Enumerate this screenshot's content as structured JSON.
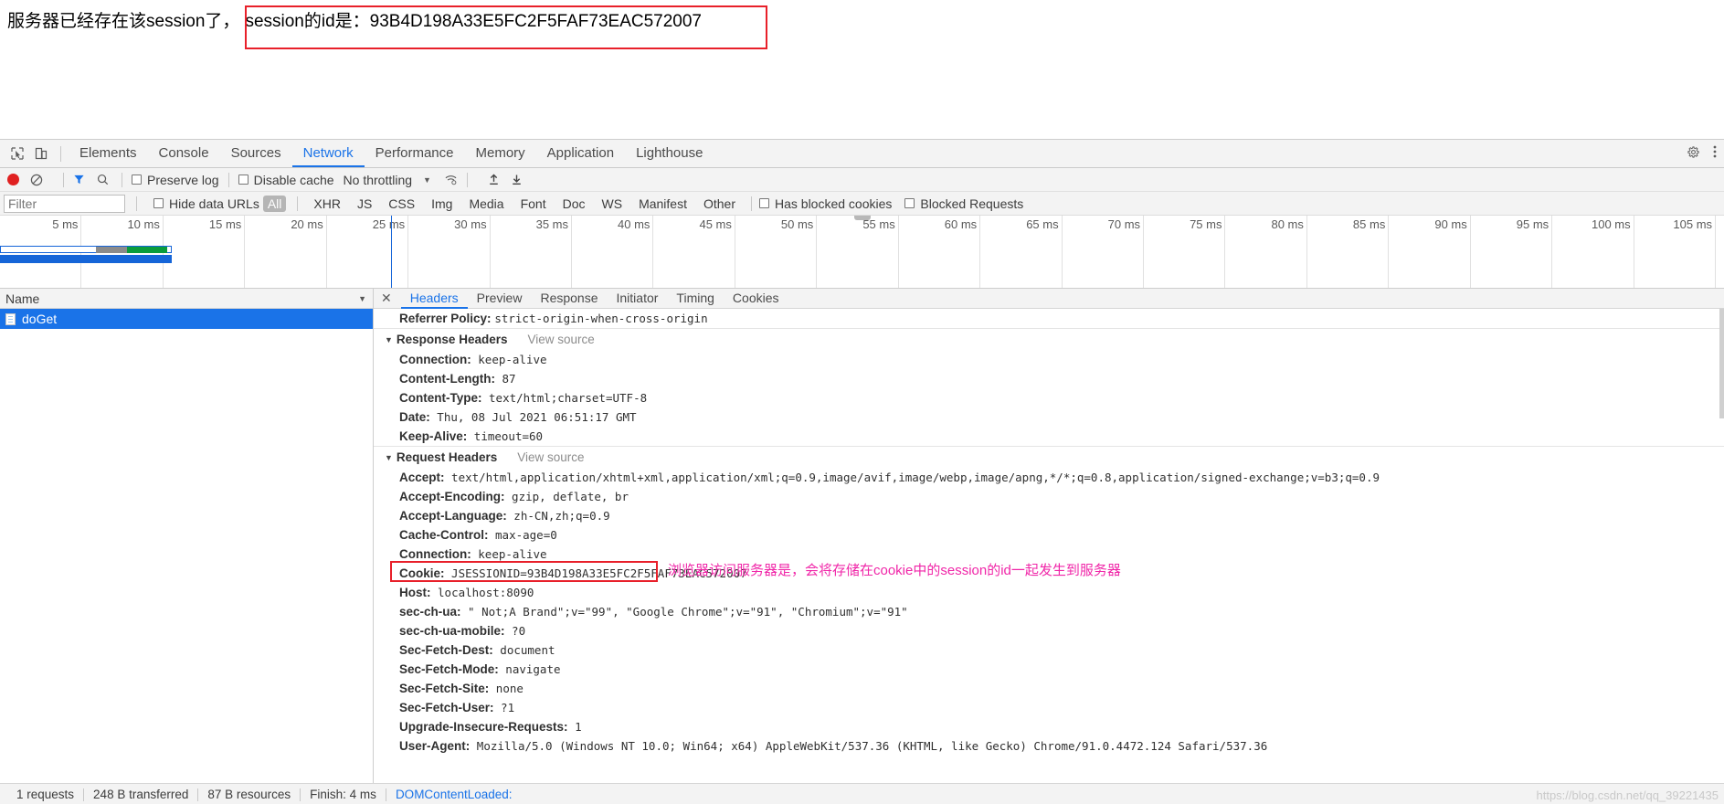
{
  "browser_page": {
    "text_prefix": "服务器已经存在该session了，",
    "highlighted_text": "session的id是：93B4D198A33E5FC2F5FAF73EAC572007",
    "highlight_color": "#e8202a"
  },
  "devtools": {
    "tabs": [
      {
        "label": "Elements",
        "active": false
      },
      {
        "label": "Console",
        "active": false
      },
      {
        "label": "Sources",
        "active": false
      },
      {
        "label": "Network",
        "active": true
      },
      {
        "label": "Performance",
        "active": false
      },
      {
        "label": "Memory",
        "active": false
      },
      {
        "label": "Application",
        "active": false
      },
      {
        "label": "Lighthouse",
        "active": false
      }
    ],
    "toolbar": {
      "record_label": "Record",
      "clear_label": "Clear",
      "filter_toggle_label": "Filter",
      "search_label": "Search",
      "preserve_log": "Preserve log",
      "disable_cache": "Disable cache",
      "throttling": "No throttling",
      "import_label": "Import HAR",
      "export_label": "Export HAR"
    },
    "filterbar": {
      "filter_placeholder": "Filter",
      "hide_data_urls": "Hide data URLs",
      "types": [
        {
          "label": "All",
          "active": true
        },
        {
          "label": "XHR",
          "active": false
        },
        {
          "label": "JS",
          "active": false
        },
        {
          "label": "CSS",
          "active": false
        },
        {
          "label": "Img",
          "active": false
        },
        {
          "label": "Media",
          "active": false
        },
        {
          "label": "Font",
          "active": false
        },
        {
          "label": "Doc",
          "active": false
        },
        {
          "label": "WS",
          "active": false
        },
        {
          "label": "Manifest",
          "active": false
        },
        {
          "label": "Other",
          "active": false
        }
      ],
      "has_blocked_cookies": "Has blocked cookies",
      "blocked_requests": "Blocked Requests"
    },
    "overview": {
      "ticks": [
        "5 ms",
        "10 ms",
        "15 ms",
        "20 ms",
        "25 ms",
        "30 ms",
        "35 ms",
        "40 ms",
        "45 ms",
        "50 ms",
        "55 ms",
        "60 ms",
        "65 ms",
        "70 ms",
        "75 ms",
        "80 ms",
        "85 ms",
        "90 ms",
        "95 ms",
        "100 ms",
        "105 ms"
      ],
      "waterfall_color_wait": "#8b8b8b",
      "waterfall_color_download": "#0b9c3c",
      "event_line_color": "#1565d8"
    },
    "request_list": {
      "column_header": "Name",
      "rows": [
        {
          "name": "doGet",
          "selected": true
        }
      ]
    },
    "detail": {
      "tabs": [
        {
          "label": "Headers",
          "active": true
        },
        {
          "label": "Preview",
          "active": false
        },
        {
          "label": "Response",
          "active": false
        },
        {
          "label": "Initiator",
          "active": false
        },
        {
          "label": "Timing",
          "active": false
        },
        {
          "label": "Cookies",
          "active": false
        }
      ],
      "top_line": {
        "name": "Referrer Policy:",
        "value": "strict-origin-when-cross-origin"
      },
      "response_headers": {
        "title": "Response Headers",
        "view_source": "View source",
        "items": [
          {
            "name": "Connection:",
            "value": "keep-alive"
          },
          {
            "name": "Content-Length:",
            "value": "87"
          },
          {
            "name": "Content-Type:",
            "value": "text/html;charset=UTF-8"
          },
          {
            "name": "Date:",
            "value": "Thu, 08 Jul 2021 06:51:17 GMT"
          },
          {
            "name": "Keep-Alive:",
            "value": "timeout=60"
          }
        ]
      },
      "request_headers": {
        "title": "Request Headers",
        "view_source": "View source",
        "items": [
          {
            "name": "Accept:",
            "value": "text/html,application/xhtml+xml,application/xml;q=0.9,image/avif,image/webp,image/apng,*/*;q=0.8,application/signed-exchange;v=b3;q=0.9"
          },
          {
            "name": "Accept-Encoding:",
            "value": "gzip, deflate, br"
          },
          {
            "name": "Accept-Language:",
            "value": "zh-CN,zh;q=0.9"
          },
          {
            "name": "Cache-Control:",
            "value": "max-age=0"
          },
          {
            "name": "Connection:",
            "value": "keep-alive"
          },
          {
            "name": "Cookie:",
            "value": "JSESSIONID=93B4D198A33E5FC2F5FAF73EAC572007",
            "highlighted": true
          },
          {
            "name": "Host:",
            "value": "localhost:8090"
          },
          {
            "name": "sec-ch-ua:",
            "value": "\" Not;A Brand\";v=\"99\", \"Google Chrome\";v=\"91\", \"Chromium\";v=\"91\""
          },
          {
            "name": "sec-ch-ua-mobile:",
            "value": "?0"
          },
          {
            "name": "Sec-Fetch-Dest:",
            "value": "document"
          },
          {
            "name": "Sec-Fetch-Mode:",
            "value": "navigate"
          },
          {
            "name": "Sec-Fetch-Site:",
            "value": "none"
          },
          {
            "name": "Sec-Fetch-User:",
            "value": "?1"
          },
          {
            "name": "Upgrade-Insecure-Requests:",
            "value": "1"
          },
          {
            "name": "User-Agent:",
            "value": "Mozilla/5.0 (Windows NT 10.0; Win64; x64) AppleWebKit/537.36 (KHTML, like Gecko) Chrome/91.0.4472.124 Safari/537.36"
          }
        ]
      },
      "cookie_annotation": "浏览器访问服务器是，会将存储在cookie中的session的id一起发生到服务器",
      "cookie_annotation_color": "#f026a8"
    },
    "status_bar": {
      "requests": "1 requests",
      "transferred": "248 B transferred",
      "resources": "87 B resources",
      "finish": "Finish: 4 ms",
      "dom_content_loaded": "DOMContentLoaded:"
    }
  },
  "watermark": "https://blog.csdn.net/qq_39221435"
}
